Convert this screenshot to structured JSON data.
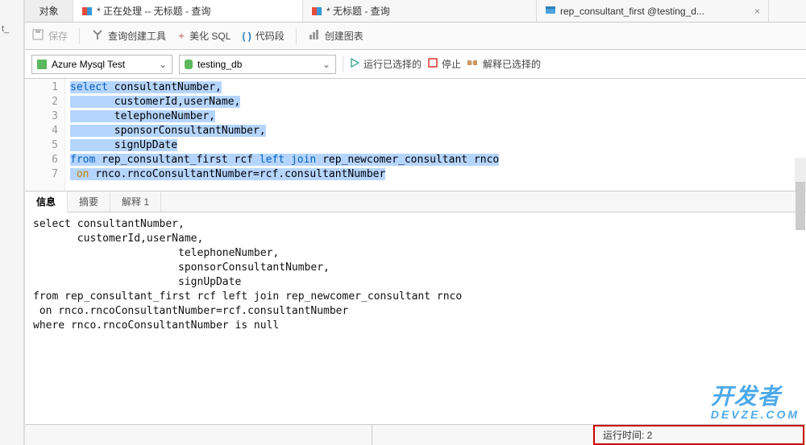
{
  "left_label": "t_",
  "tabs": {
    "object": "对象",
    "t1": "* 正在处理 -- 无标题 - 查询",
    "t2": "* 无标题 - 查询",
    "t3": "rep_consultant_first @testing_d..."
  },
  "toolbar": {
    "save": "保存",
    "query_builder": "查询创建工具",
    "beautify": "美化 SQL",
    "snippet": "代码段",
    "chart": "创建图表"
  },
  "conn": {
    "connection": "Azure Mysql Test",
    "database": "testing_db",
    "run": "运行已选择的",
    "stop": "停止",
    "explain": "解释已选择的"
  },
  "editor": {
    "lines": [
      "1",
      "2",
      "3",
      "4",
      "5",
      "6",
      "7"
    ],
    "l1a": "select",
    "l1b": " consultantNumber,",
    "l2": "       customerId,userName,",
    "l3": "       telephoneNumber,",
    "l4": "       sponsorConsultantNumber,",
    "l5": "       signUpDate",
    "l6a": "from",
    "l6b": " rep_consultant_first rcf ",
    "l6c": "left join",
    "l6d": " rep_newcomer_consultant rnco",
    "l7a": " on",
    "l7b": " rnco.rncoConsultantNumber=rcf.consultantNumber"
  },
  "result_tabs": {
    "info": "信息",
    "summary": "摘要",
    "explain": "解释 1"
  },
  "message": "select consultantNumber,\n       customerId,userName,\n                       telephoneNumber,\n                       sponsorConsultantNumber,\n                       signUpDate\nfrom rep_consultant_first rcf left join rep_newcomer_consultant rnco\n on rnco.rncoConsultantNumber=rcf.consultantNumber\nwhere rnco.rncoConsultantNumber is null",
  "status": {
    "runtime_label": "运行时间: 2",
    "runtime_rest": ""
  },
  "watermark": {
    "main": "开发者",
    "sub": "DEVZE.COM"
  }
}
